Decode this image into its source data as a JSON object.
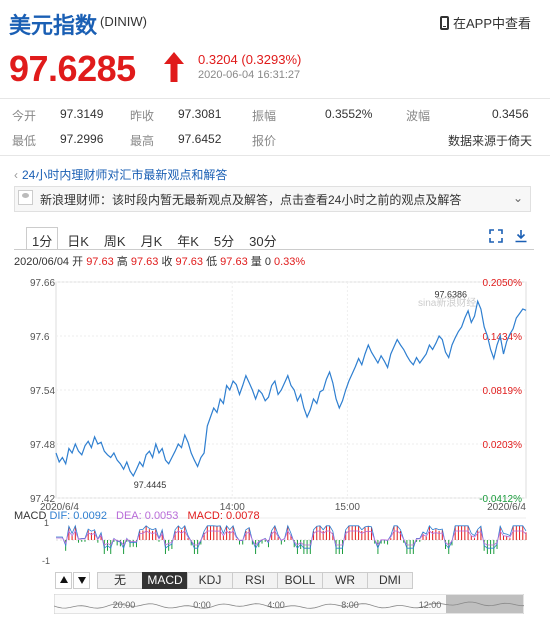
{
  "header": {
    "title": "美元指数",
    "code": "(DINIW)",
    "app_link": "在APP中查看"
  },
  "quote": {
    "price": "97.6285",
    "change": "0.3204 (0.3293%)",
    "timestamp": "2020-06-04 16:31:27"
  },
  "stats": {
    "row1": [
      {
        "label": "今开",
        "value": "97.3149"
      },
      {
        "label": "昨收",
        "value": "97.3081"
      },
      {
        "label": "振幅",
        "value": "0.3552%"
      },
      {
        "label": "波幅",
        "value": "0.3456"
      }
    ],
    "row2": [
      {
        "label": "最低",
        "value": "97.2996"
      },
      {
        "label": "最高",
        "value": "97.6452"
      },
      {
        "label": "报价",
        "value": ""
      },
      {
        "label": "",
        "value": "数据来源于倚天"
      }
    ]
  },
  "news": {
    "headline": "24小时内理财师对汇市最新观点和解答",
    "text": "新浪理财师：该时段内暂无最新观点及解答，点击查看24小时之前的观点及解答"
  },
  "tabs": [
    "1分",
    "日K",
    "周K",
    "月K",
    "年K",
    "5分",
    "30分"
  ],
  "active_tab": "1分",
  "ohlc": {
    "date": "2020/06/04",
    "open_label": "开",
    "open": "97.63",
    "high_label": "高",
    "high": "97.63",
    "close_label": "收",
    "close": "97.63",
    "low_label": "低",
    "low": "97.63",
    "volume_label": "量",
    "volume": "0",
    "pct": "0.33%"
  },
  "watermark": "sina新浪财经",
  "macd": {
    "label": "MACD",
    "dif_label": "DIF:",
    "dif": "0.0092",
    "dea_label": "DEA:",
    "dea": "0.0053",
    "macd_label": "MACD:",
    "macd": "0.0078",
    "ymax": "1",
    "ymin": "-1"
  },
  "indicator_tabs": [
    "无",
    "MACD",
    "KDJ",
    "RSI",
    "BOLL",
    "WR",
    "DMI"
  ],
  "active_indicator": "MACD",
  "navigator": {
    "ticks": [
      "20:00",
      "0:00",
      "4:00",
      "8:00",
      "12:00"
    ]
  },
  "colors": {
    "up": "#e01b1b",
    "down": "#1a9c3c",
    "line": "#2f7fd0",
    "brand": "#1a5fb4"
  },
  "chart_data": {
    "type": "line",
    "title": "",
    "xlabel": "",
    "ylabel": "",
    "y_ticks_left": [
      "97.66",
      "97.6",
      "97.54",
      "97.48",
      "97.42"
    ],
    "y_ticks_right": [
      "0.2050%",
      "0.1434%",
      "0.0819%",
      "0.0203%",
      "-0.0412%"
    ],
    "x_ticks": [
      "2020/6/4",
      "14:00",
      "15:00",
      "2020/6/4"
    ],
    "ylim": [
      97.42,
      97.66
    ],
    "annotations": [
      {
        "label": "97.6386",
        "x": 0.84,
        "y": 97.6386
      },
      {
        "label": "97.4445",
        "x": 0.2,
        "y": 97.4445
      }
    ],
    "series": [
      {
        "values": [
          97.47,
          97.46,
          97.465,
          97.458,
          97.475,
          97.47,
          97.48,
          97.472,
          97.468,
          97.478,
          97.483,
          97.476,
          97.488,
          97.48,
          97.482,
          97.472,
          97.468,
          97.465,
          97.47,
          97.462,
          97.458,
          97.452,
          97.46,
          97.45,
          97.4445,
          97.452,
          97.46,
          97.455,
          97.468,
          97.472,
          97.465,
          97.48,
          97.47,
          97.475,
          97.462,
          97.458,
          97.465,
          97.472,
          97.48,
          97.476,
          97.49,
          97.482,
          97.47,
          97.462,
          97.455,
          97.465,
          97.47,
          97.5,
          97.51,
          97.52,
          97.515,
          97.53,
          97.525,
          97.545,
          97.54,
          97.55,
          97.546,
          97.535,
          97.545,
          97.556,
          97.548,
          97.54,
          97.53,
          97.54,
          97.536,
          97.528,
          97.532,
          97.545,
          97.55,
          97.535,
          97.54,
          97.548,
          97.556,
          97.545,
          97.54,
          97.528,
          97.535,
          97.52,
          97.51,
          97.518,
          97.53,
          97.525,
          97.538,
          97.54,
          97.552,
          97.56,
          97.548,
          97.53,
          97.52,
          97.528,
          97.54,
          97.55,
          97.558,
          97.566,
          97.575,
          97.568,
          97.58,
          97.59,
          97.582,
          97.576,
          97.57,
          97.578,
          97.572,
          97.565,
          97.58,
          97.588,
          97.596,
          97.59,
          97.585,
          97.578,
          97.572,
          97.568,
          97.576,
          97.57,
          97.575,
          97.58,
          97.59,
          97.585,
          97.592,
          97.6,
          97.596,
          97.582,
          97.576,
          97.59,
          97.598,
          97.605,
          97.61,
          97.62,
          97.628,
          97.615,
          97.622,
          97.6386,
          97.63,
          97.61,
          97.6,
          97.585,
          97.575,
          97.59,
          97.6,
          97.58,
          97.594,
          97.602,
          97.608,
          97.62,
          97.625,
          97.63,
          97.6285
        ]
      }
    ]
  }
}
